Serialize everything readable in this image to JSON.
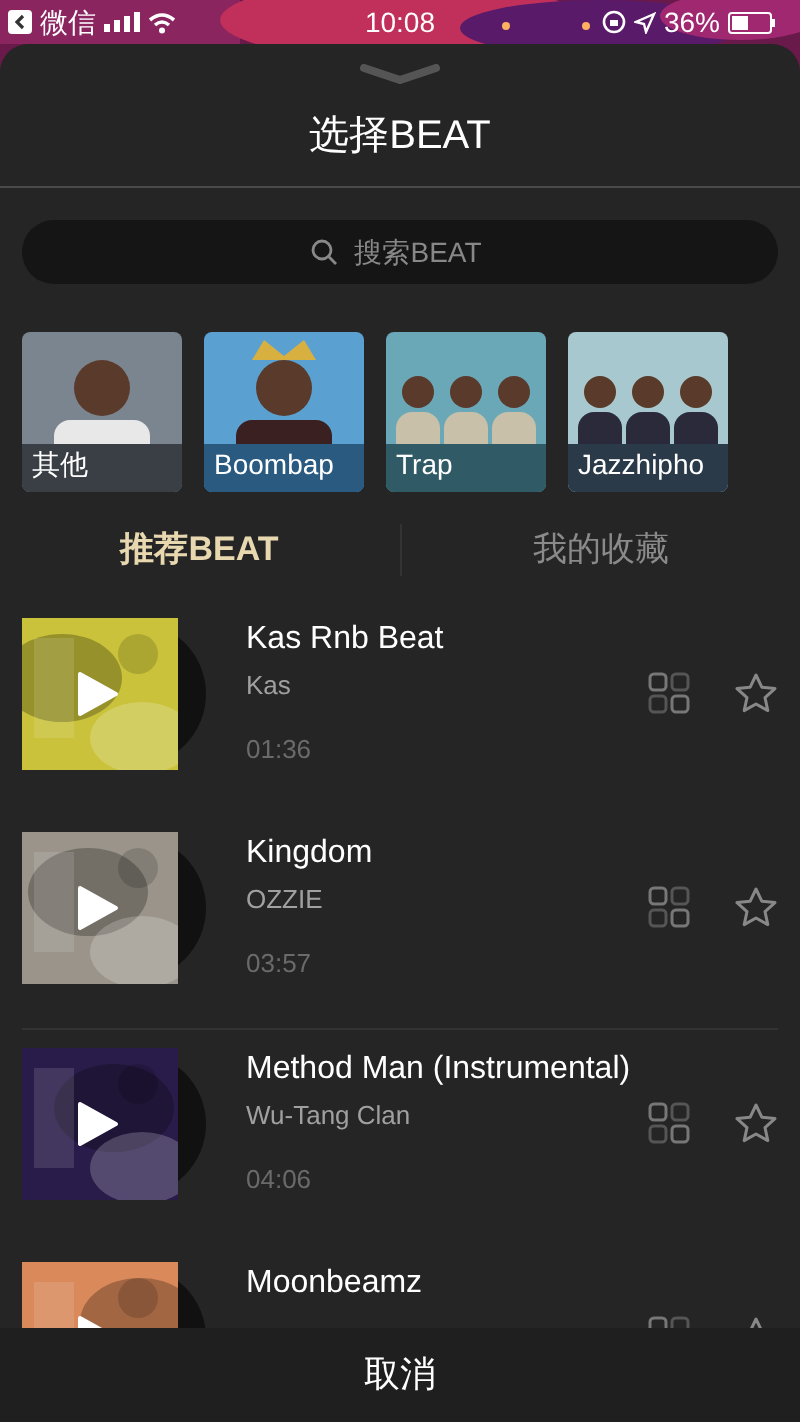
{
  "status_bar": {
    "carrier": "微信",
    "time": "10:08",
    "battery": "36%"
  },
  "title": "选择BEAT",
  "search": {
    "placeholder": "搜索BEAT"
  },
  "genres": [
    {
      "label": "其他",
      "kind": "picture"
    },
    {
      "label": "Boombap",
      "kind": "picture"
    },
    {
      "label": "Trap",
      "kind": "picture"
    },
    {
      "label": "Jazzhipho",
      "kind": "picture"
    }
  ],
  "tabs": [
    {
      "label": "推荐BEAT",
      "selected": true
    },
    {
      "label": "我的收藏",
      "selected": false
    }
  ],
  "beats": [
    {
      "title": "Kas Rnb Beat",
      "artist": "Kas",
      "duration": "01:36"
    },
    {
      "title": "Kingdom",
      "artist": "OZZIE",
      "duration": "03:57"
    },
    {
      "title": "Method Man (Instrumental)",
      "artist": "Wu-Tang Clan",
      "duration": "04:06"
    },
    {
      "title": "Moonbeamz"
    }
  ],
  "cancel": "取消"
}
